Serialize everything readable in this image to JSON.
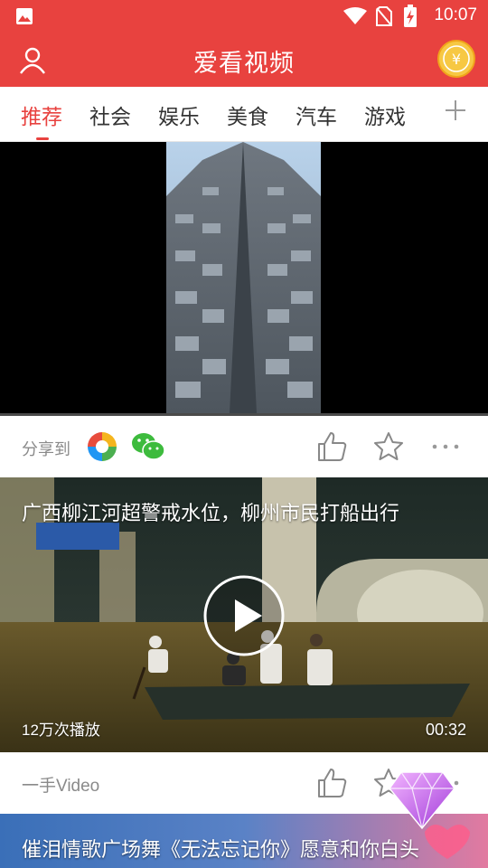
{
  "status_bar": {
    "time": "10:07"
  },
  "app_bar": {
    "title": "爱看视频"
  },
  "tabs": [
    {
      "label": "推荐",
      "active": true
    },
    {
      "label": "社会"
    },
    {
      "label": "娱乐"
    },
    {
      "label": "美食"
    },
    {
      "label": "汽车"
    },
    {
      "label": "游戏"
    }
  ],
  "feed": {
    "item1": {
      "share_label": "分享到"
    },
    "item2": {
      "title": "广西柳江河超警戒水位，柳州市民打船出行",
      "play_count": "12万次播放",
      "duration": "00:32",
      "source": "一手Video"
    },
    "item3": {
      "title": "催泪情歌广场舞《无法忘记你》愿意和你白头"
    }
  },
  "colors": {
    "brand_red": "#e8423f",
    "muted_text": "#8a8a8a"
  },
  "icons": [
    "image-icon",
    "wifi-icon",
    "no-sim-icon",
    "battery-icon",
    "user-icon",
    "coin-icon",
    "plus-icon",
    "play-icon",
    "photos-share-icon",
    "wechat-icon",
    "like-icon",
    "favorite-star-icon",
    "more-icon",
    "diamond-icon"
  ]
}
